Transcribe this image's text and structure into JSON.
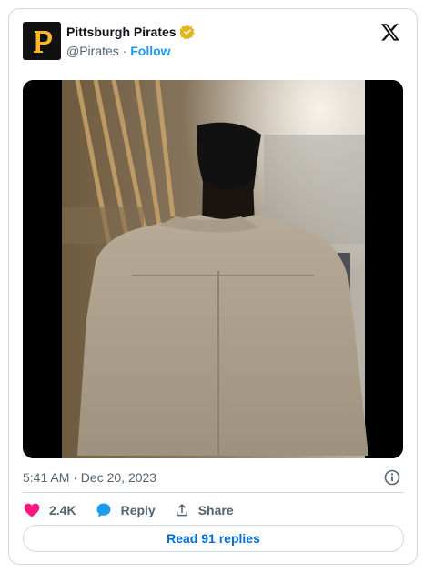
{
  "author": {
    "display_name": "Pittsburgh Pirates",
    "handle": "@Pirates",
    "separator": "·",
    "follow_label": "Follow",
    "verified": true,
    "avatar_letter": "P",
    "avatar_bg": "#111111",
    "avatar_letter_color": "#fdb827"
  },
  "platform_logo": "x-logo-icon",
  "media": {
    "type": "video-frame",
    "description_icon": "video-still"
  },
  "timestamp": "5:41 AM · Dec 20, 2023",
  "actions": {
    "like": {
      "icon": "heart-icon",
      "count": "2.4K",
      "color": "#f91880"
    },
    "reply": {
      "icon": "speech-bubble-icon",
      "label": "Reply",
      "color": "#1d9bf0"
    },
    "share": {
      "icon": "share-upload-icon",
      "label": "Share"
    }
  },
  "replies_button_label": "Read 91 replies",
  "colors": {
    "accent": "#1d9bf0",
    "link": "#006fd6",
    "muted": "#536471",
    "border": "#cfd9de",
    "verified_gold": "#e2b719"
  }
}
